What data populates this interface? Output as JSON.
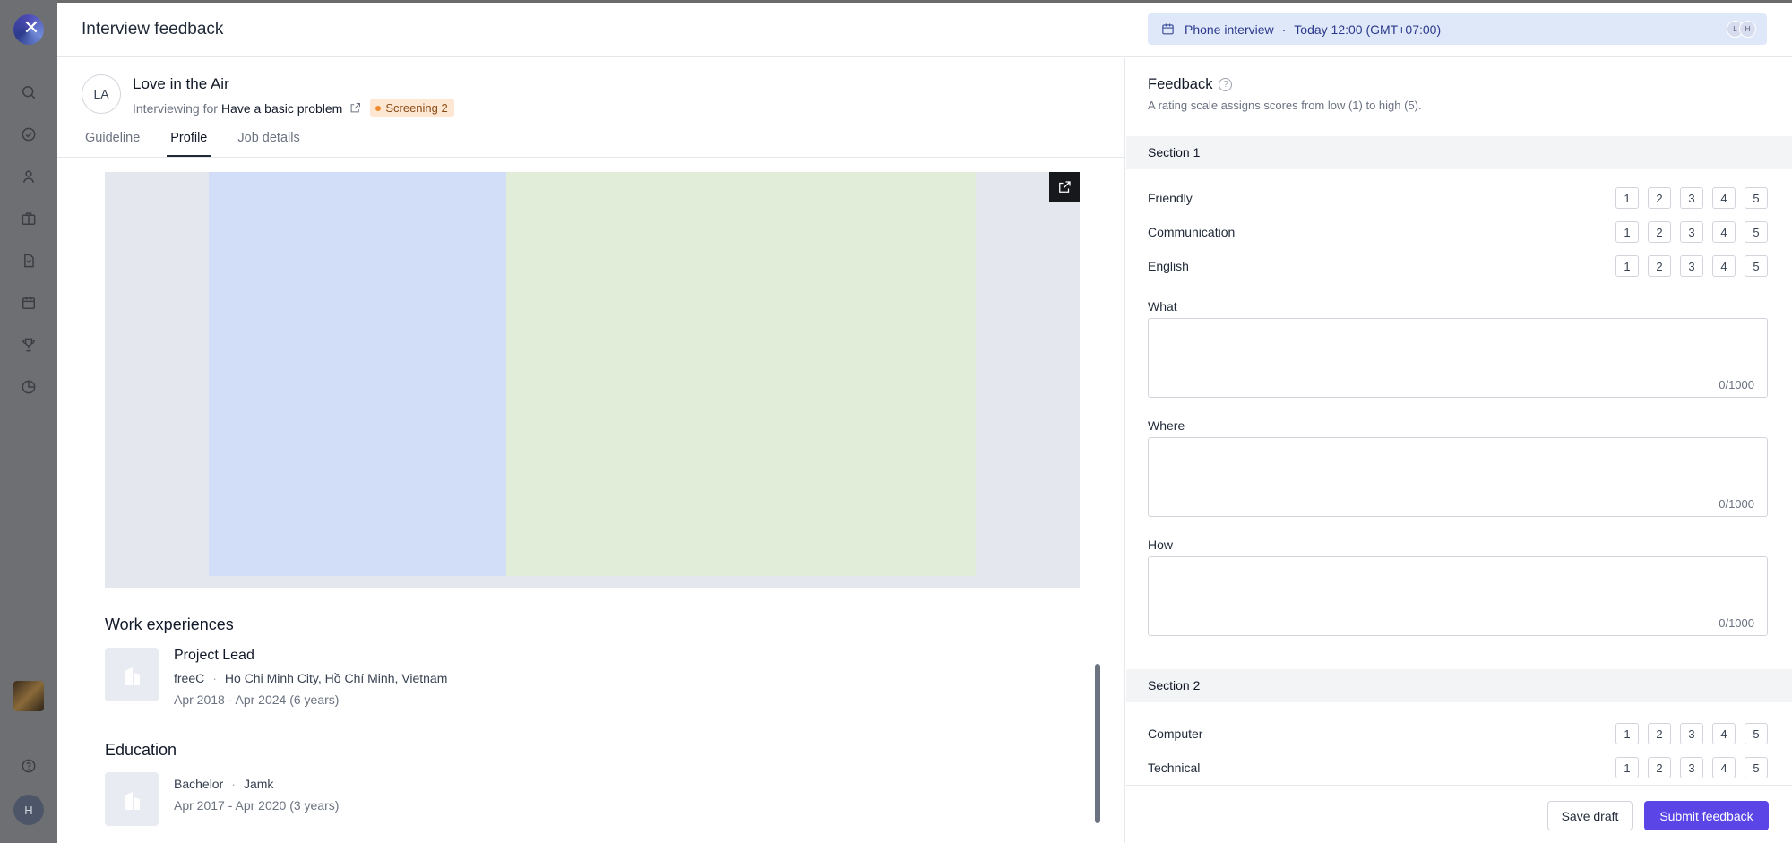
{
  "app": {
    "close_glyph": "✕",
    "user_initial": "H",
    "sidebar_icons": [
      "search-icon",
      "check-circle-icon",
      "user-icon",
      "briefcase-icon",
      "document-icon",
      "calendar-icon",
      "trophy-icon",
      "pie-chart-icon"
    ]
  },
  "header": {
    "title": "Interview feedback",
    "interview_type": "Phone interview",
    "separator": "·",
    "interview_time": "Today 12:00 (GMT+07:00)",
    "attendee_avatars": [
      "L",
      "H"
    ]
  },
  "candidate": {
    "initials": "LA",
    "name": "Love in the Air",
    "interviewing_for_label": "Interviewing for",
    "job": "Have a basic problem",
    "stage": "Screening 2",
    "stage_color": "#f08a2c"
  },
  "tabs": [
    "Guideline",
    "Profile",
    "Job details"
  ],
  "active_tab": "Profile",
  "profile": {
    "work_heading": "Work experiences",
    "work": {
      "title": "Project Lead",
      "company": "freeC",
      "location": "Ho Chi Minh City, Hồ Chí Minh, Vietnam",
      "dates": "Apr 2018 - Apr 2024 (6 years)"
    },
    "education_heading": "Education",
    "education": {
      "degree": "Bachelor",
      "school": "Jamk",
      "dates": "Apr 2017 - Apr 2020 (3 years)"
    }
  },
  "feedback": {
    "title": "Feedback",
    "subtitle": "A rating scale assigns scores from low (1) to high (5).",
    "scale": [
      "1",
      "2",
      "3",
      "4",
      "5"
    ],
    "section1": {
      "title": "Section 1",
      "ratings": [
        "Friendly",
        "Communication",
        "English"
      ],
      "questions": [
        {
          "label": "What",
          "counter": "0/1000"
        },
        {
          "label": "Where",
          "counter": "0/1000"
        },
        {
          "label": "How",
          "counter": "0/1000"
        }
      ]
    },
    "section2": {
      "title": "Section 2",
      "ratings": [
        "Computer",
        "Technical"
      ]
    },
    "save_draft": "Save draft",
    "submit": "Submit feedback",
    "accent": "#5b45e6"
  }
}
